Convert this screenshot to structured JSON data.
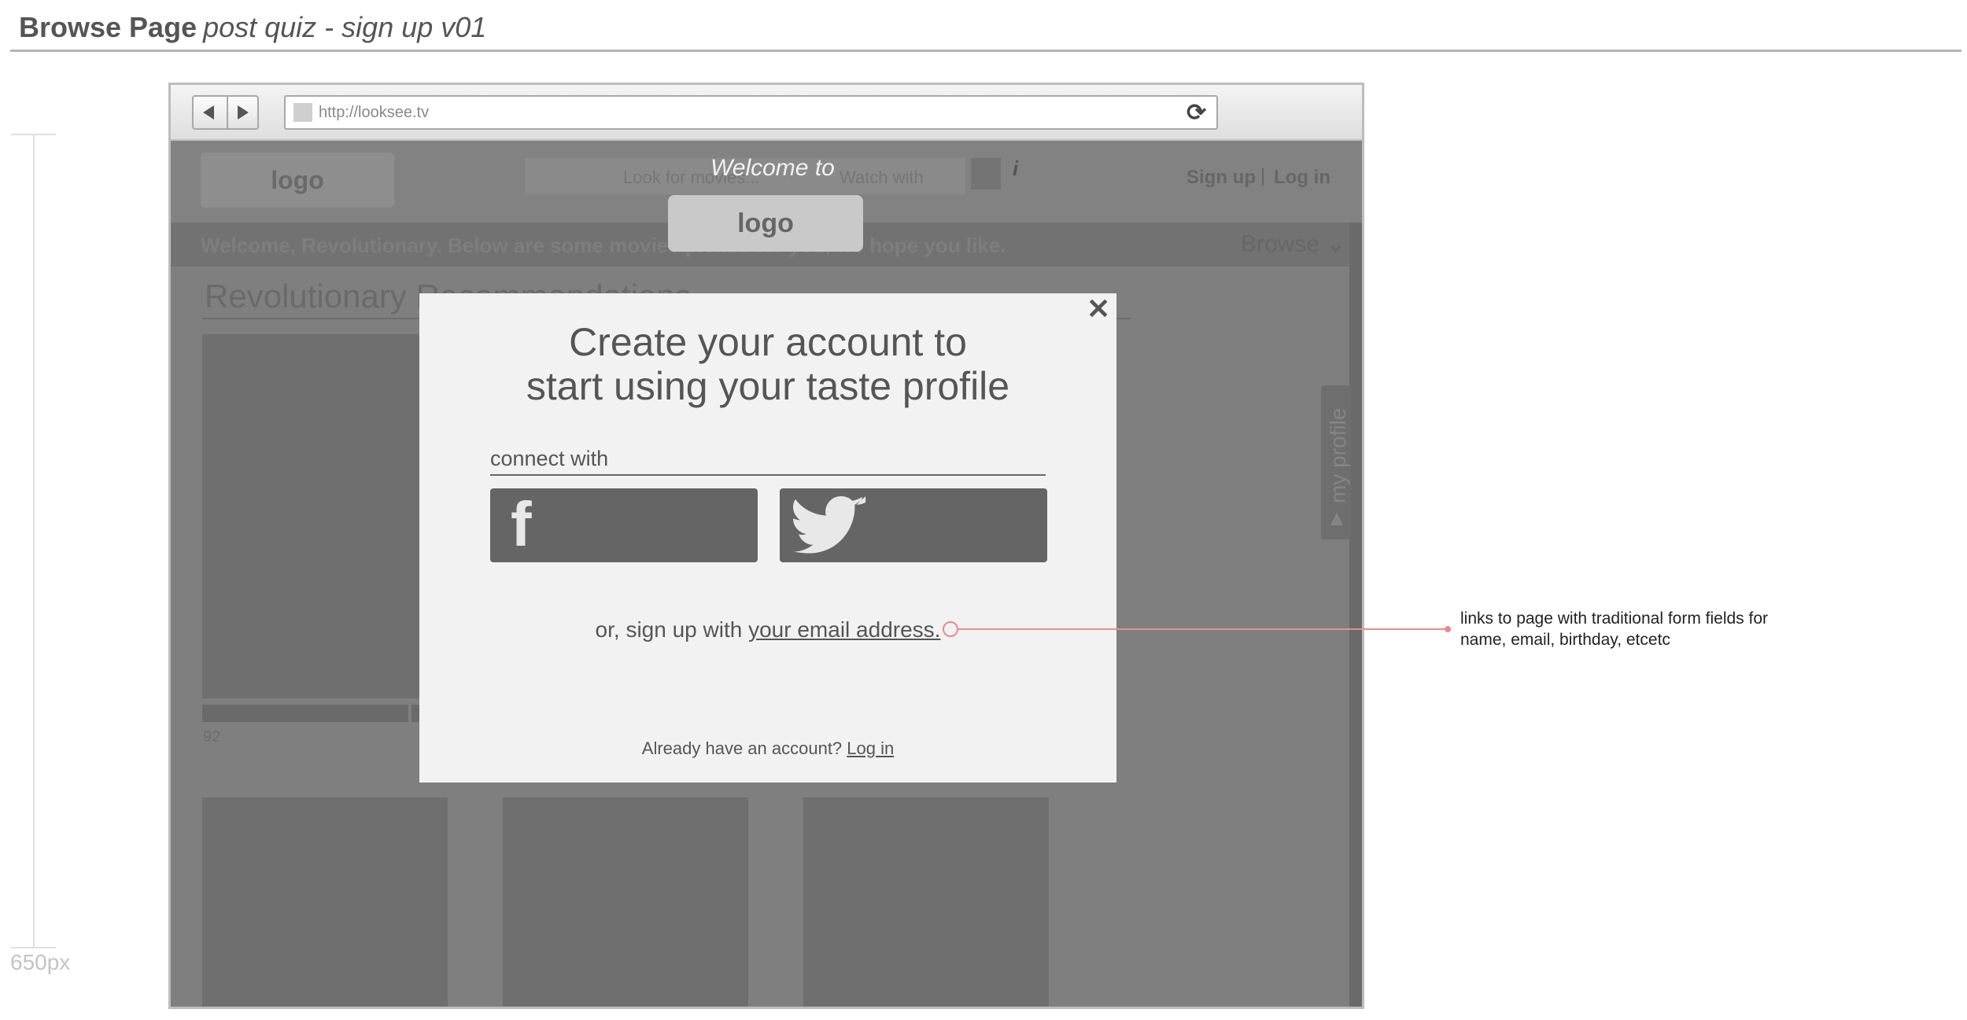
{
  "heading": {
    "bold": "Browse Page",
    "italic": "post quiz - sign up v01"
  },
  "ruler": {
    "label": "650px"
  },
  "browser": {
    "url": "http://looksee.tv",
    "icons": {
      "back": "back-arrow-icon",
      "forward": "forward-arrow-icon",
      "reload": "reload-icon"
    }
  },
  "site": {
    "logo": "logo",
    "search_placeholder": "Look for movies...",
    "watch_placeholder": "Watch with",
    "info": "i",
    "signup": "Sign up",
    "separator": "|",
    "login": "Log in",
    "welcome_text": "Welcome, Revolutionary. Below are some movies picked for you, we hope you like.",
    "browse": "Browse ⌄",
    "profile_tab": "my profile",
    "section_title": "Revolutionary Recommendations",
    "card_score": "92"
  },
  "modal": {
    "welcome_to": "Welcome to",
    "logo": "logo",
    "close": "✕",
    "title_line1": "Create your account to",
    "title_line2": "start using your taste profile",
    "connect_label": "connect with",
    "facebook_glyph": "f",
    "email_prefix": "or, sign up with ",
    "email_link": "your email address.",
    "login_prefix": "Already have an account? ",
    "login_link": "Log in"
  },
  "annotation": {
    "line1": "links to page with traditional form fields for",
    "line2": "name, email, birthday, etcetc"
  },
  "colors": {
    "annotation": "#e88a8a",
    "overlay": "#7f7f7f",
    "modal_bg": "#f2f2f2",
    "social_button": "#656565"
  }
}
